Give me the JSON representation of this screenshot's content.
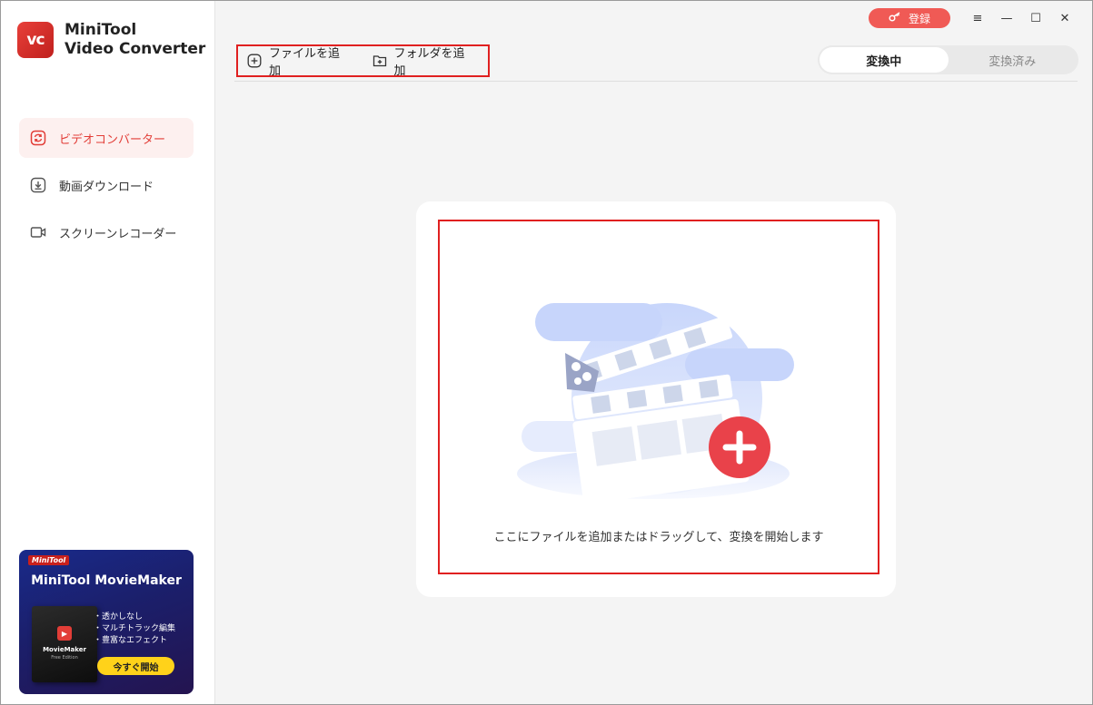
{
  "app": {
    "logo_text": "vc",
    "name_line1": "MiniTool",
    "name_line2": "Video Converter"
  },
  "sidebar": {
    "items": [
      {
        "label": "ビデオコンバーター",
        "icon": "convert-icon",
        "active": true
      },
      {
        "label": "動画ダウンロード",
        "icon": "download-icon",
        "active": false
      },
      {
        "label": "スクリーンレコーダー",
        "icon": "camera-icon",
        "active": false
      }
    ]
  },
  "promo": {
    "badge": "MiniTool",
    "title": "MiniTool MovieMaker",
    "box_name": "MovieMaker",
    "box_sub": "Free Edition",
    "features": [
      "・透かしなし",
      "・マルチトラック編集",
      "・豊富なエフェクト"
    ],
    "button": "今すぐ開始"
  },
  "header": {
    "register_label": "登録",
    "menu_icon": "≡",
    "minimize_icon": "—",
    "maximize_icon": "☐",
    "close_icon": "✕"
  },
  "toolbar": {
    "add_file_label": "ファイルを追加",
    "add_folder_label": "フォルダを追加"
  },
  "tabs": {
    "converting": "変換中",
    "converted": "変換済み"
  },
  "dropzone": {
    "text": "ここにファイルを追加またはドラッグして、変換を開始します"
  },
  "colors": {
    "accent": "#e23d37",
    "highlight_border": "#e02020",
    "register_bg": "#f05a55"
  }
}
